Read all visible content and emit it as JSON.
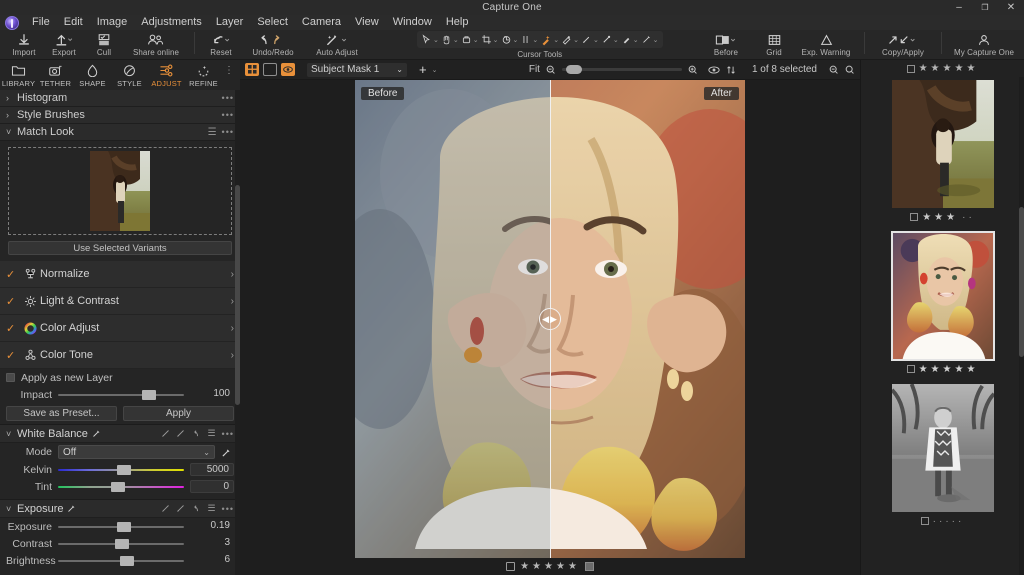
{
  "window": {
    "title": "Capture One",
    "minimize": "–",
    "maximize": "❐",
    "close": "✕"
  },
  "menubar": {
    "logo_icon": "capture-one-logo",
    "items": [
      "File",
      "Edit",
      "Image",
      "Adjustments",
      "Layer",
      "Select",
      "Camera",
      "View",
      "Window",
      "Help"
    ]
  },
  "toolbar": {
    "left_group": [
      {
        "label": "Import",
        "icon": "import-icon",
        "caret": false
      },
      {
        "label": "Export",
        "icon": "export-icon",
        "caret": true
      },
      {
        "label": "Cull",
        "icon": "cull-icon",
        "caret": false
      },
      {
        "label": "Share online",
        "icon": "share-online-icon",
        "caret": false
      },
      {
        "label": "Reset",
        "icon": "reset-icon",
        "caret": true
      },
      {
        "label": "Undo/Redo",
        "icon": "undo-redo-icon",
        "caret": false
      },
      {
        "label": "Auto Adjust",
        "icon": "auto-adjust-icon",
        "caret": true
      }
    ],
    "cursor_tools": {
      "label": "Cursor Tools",
      "tools": [
        "pan-cursor-icon",
        "hand-cursor-icon",
        "color-picker-icon",
        "crop-icon",
        "rotate-icon",
        "straighten-icon",
        "heal-brush-icon",
        "eraser-icon",
        "draw-mask-icon",
        "gradient-mask-icon",
        "brush-icon",
        "linear-mask-icon"
      ],
      "active_index": 6
    },
    "right_group": [
      {
        "label": "Before",
        "icon": "before-after-icon",
        "caret": true
      },
      {
        "label": "Grid",
        "icon": "grid-icon",
        "caret": false
      },
      {
        "label": "Exp. Warning",
        "icon": "exposure-warning-icon",
        "caret": false
      },
      {
        "label": "Copy/Apply",
        "icon": "copy-apply-icon",
        "caret": true
      },
      {
        "label": "My Capture One",
        "icon": "user-account-icon",
        "caret": false
      }
    ]
  },
  "left_panel": {
    "tool_tabs": [
      {
        "label": "LIBRARY",
        "icon": "folder-icon"
      },
      {
        "label": "TETHER",
        "icon": "camera-tether-icon"
      },
      {
        "label": "SHAPE",
        "icon": "shape-icon"
      },
      {
        "label": "STYLE",
        "icon": "style-icon"
      },
      {
        "label": "ADJUST",
        "icon": "adjust-sliders-icon"
      },
      {
        "label": "REFINE",
        "icon": "refine-icon"
      }
    ],
    "active_tab": "ADJUST",
    "collapsed_panels": [
      {
        "title": "Histogram",
        "caret": "›"
      },
      {
        "title": "Style Brushes",
        "caret": "›"
      }
    ],
    "match_look": {
      "title": "Match Look",
      "caret": "˅",
      "dropzone_thumb": "reference-image-thumbnail",
      "use_selected_button": "Use Selected Variants",
      "rows": [
        {
          "label": "Normalize",
          "icon": "normalize-icon",
          "checked": true,
          "arrow": "›"
        },
        {
          "label": "Light & Contrast",
          "icon": "light-contrast-icon",
          "checked": true,
          "arrow": "›"
        },
        {
          "label": "Color Adjust",
          "icon": "color-wheel-icon",
          "checked": true,
          "arrow": "›"
        },
        {
          "label": "Color Tone",
          "icon": "color-tone-icon",
          "checked": true,
          "arrow": "›"
        }
      ],
      "apply_as_new_layer": "Apply as new Layer",
      "impact": {
        "label": "Impact",
        "value": "100",
        "pct": 72
      },
      "save_preset_button": "Save as Preset...",
      "apply_button": "Apply"
    },
    "white_balance": {
      "title": "White Balance",
      "caret": "˅",
      "mode": {
        "label": "Mode",
        "value": "Off"
      },
      "sliders": [
        {
          "label": "Kelvin",
          "value": "5000",
          "pct": 52,
          "track": "kelvin"
        },
        {
          "label": "Tint",
          "value": "0",
          "pct": 48,
          "track": "tint"
        }
      ]
    },
    "exposure": {
      "title": "Exposure",
      "caret": "˅",
      "sliders": [
        {
          "label": "Exposure",
          "value": "0.19",
          "pct": 52
        },
        {
          "label": "Contrast",
          "value": "3",
          "pct": 51
        },
        {
          "label": "Brightness",
          "value": "6",
          "pct": 55
        }
      ]
    }
  },
  "viewer_bar": {
    "view_buttons": [
      "grid-view-icon",
      "single-view-icon",
      "mask-view-icon"
    ],
    "mask_select": {
      "value": "Subject Mask 1",
      "caret": "˅"
    },
    "add_button": "+",
    "fit_label": "Fit",
    "zoom_out_icon": "zoom-out-icon",
    "zoom_in_icon": "zoom-in-icon",
    "eye_icon": "visibility-icon",
    "sort_icon": "sort-icon",
    "selection_count": "1 of 8 selected",
    "search_zoom_icon": "zoom-tool-icon",
    "search_icon": "search-icon"
  },
  "viewer": {
    "before_label": "Before",
    "after_label": "After",
    "split_handle_icon": "split-compare-handle-icon",
    "split_position_pct": 50,
    "footer": {
      "stars": "★★★★★",
      "color_tag_icon": "color-tag-icon",
      "checkbox_icon": "select-checkbox-icon"
    }
  },
  "browser": {
    "header_stars": "★★★★★",
    "thumbnails": [
      {
        "name": "tree-portrait-thumbnail",
        "stars_filled": 3,
        "stars_total": 5,
        "selected": false
      },
      {
        "name": "blonde-portrait-thumbnail",
        "stars_filled": 5,
        "stars_total": 5,
        "selected": true
      },
      {
        "name": "bw-portrait-thumbnail",
        "stars_filled": 0,
        "stars_total": 5,
        "selected": false
      }
    ]
  }
}
